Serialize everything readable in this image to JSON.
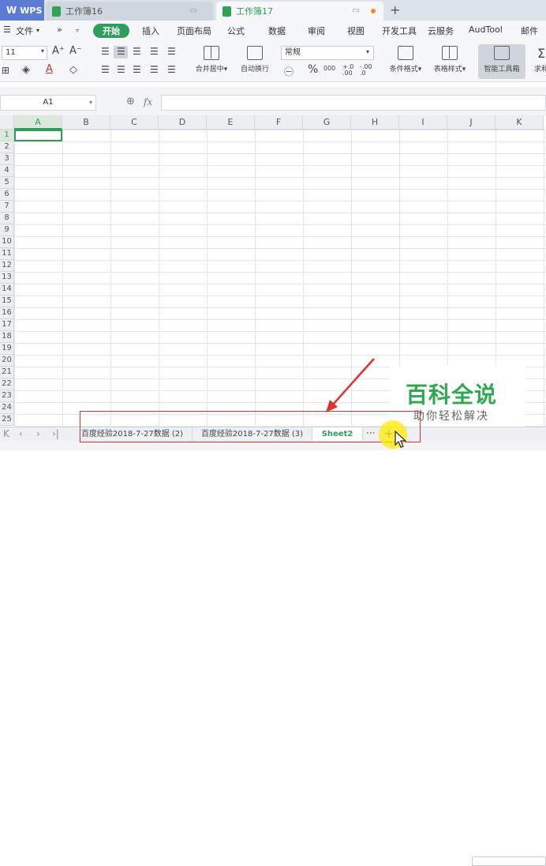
{
  "titlebar": {
    "wps_label": "WPS",
    "tabs": [
      {
        "label": "工作簿16"
      },
      {
        "label": "工作簿17"
      }
    ],
    "new_tab": "+"
  },
  "menu": {
    "file": "文件",
    "items": [
      "开始",
      "插入",
      "页面布局",
      "公式",
      "数据",
      "审阅",
      "视图",
      "开发工具",
      "云服务",
      "AudTool",
      "邮件"
    ]
  },
  "ribbon": {
    "font_size": "11",
    "font_grow": "A⁺",
    "font_shrink": "A⁻",
    "merge_center": "合并居中",
    "wrap_text": "自动换行",
    "number_format": "常规",
    "percent": "%",
    "thousands": "000",
    "dec_inc": "+.0 .00",
    "dec_dec": "-.00 .0",
    "cond_format": "条件格式",
    "table_style": "表格样式",
    "smart_tools": "智能工具箱",
    "sum_partial": "求和"
  },
  "formula": {
    "name_box": "A1",
    "fx": "fx",
    "value": ""
  },
  "grid": {
    "columns": [
      "A",
      "B",
      "C",
      "D",
      "E",
      "F",
      "G",
      "H",
      "I",
      "J",
      "K"
    ],
    "rows": [
      "1",
      "2",
      "3",
      "4",
      "5",
      "6",
      "7",
      "8",
      "9",
      "10",
      "11",
      "12",
      "13",
      "14",
      "15",
      "16",
      "17",
      "18",
      "19",
      "20",
      "21",
      "22",
      "23",
      "24",
      "25"
    ],
    "active_cell": "A1"
  },
  "sheets": {
    "tabs": [
      {
        "label": "百度经验2018-7-27数据 (2)"
      },
      {
        "label": "百度经验2018-7-27数据 (3)"
      },
      {
        "label": "Sheet2"
      }
    ],
    "more": "···",
    "add": "+"
  },
  "watermark": {
    "title": "百科全说",
    "subtitle": "助你轻松解决"
  },
  "colors": {
    "accent": "#2f9e5b",
    "highlight": "#e0312f",
    "cursor_glow": "#ffeb00"
  }
}
